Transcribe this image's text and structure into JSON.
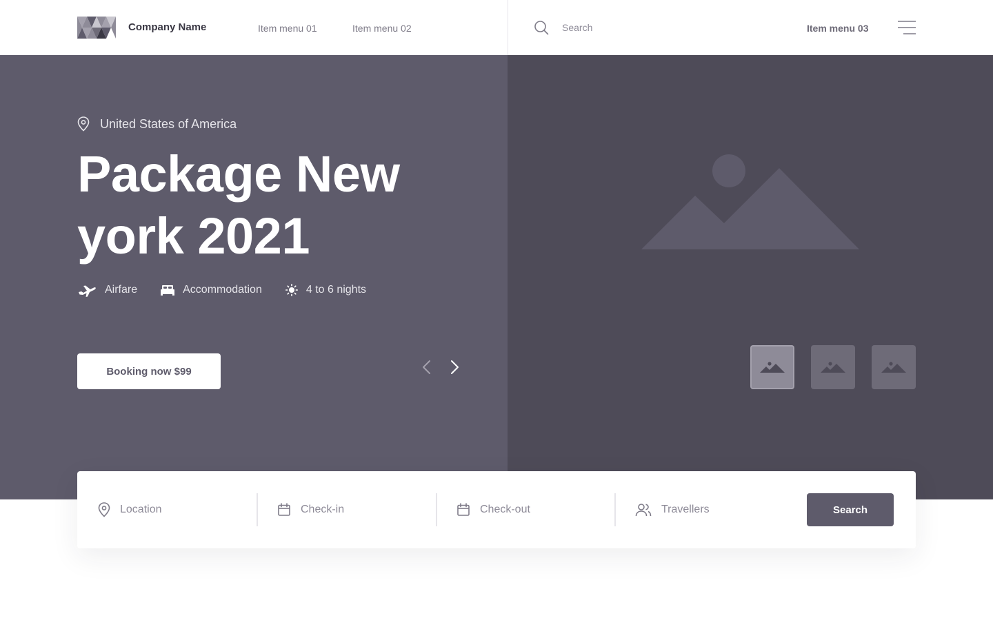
{
  "header": {
    "company_name": "Company Name",
    "nav": [
      "Item menu 01",
      "Item menu 02",
      "Item menu 03"
    ],
    "search_placeholder": "Search",
    "logo_icon": "triangles-logo",
    "menu_icon": "hamburger-icon"
  },
  "hero": {
    "location": "United States of America",
    "title": "Package New york 2021",
    "features": [
      {
        "icon": "airplane-icon",
        "label": "Airfare"
      },
      {
        "icon": "bed-icon",
        "label": "Accommodation"
      },
      {
        "icon": "sun-icon",
        "label": "4 to 6 nights"
      }
    ],
    "booking_label": "Booking now $99",
    "thumbnail_count": 3,
    "active_thumbnail": 1
  },
  "search_bar": {
    "fields": [
      {
        "icon": "pin-icon",
        "placeholder": "Location"
      },
      {
        "icon": "calendar-icon",
        "placeholder": "Check-in"
      },
      {
        "icon": "calendar-icon",
        "placeholder": "Check-out"
      },
      {
        "icon": "users-icon",
        "placeholder": "Travellers"
      }
    ],
    "button_label": "Search"
  },
  "colors": {
    "hero_left": "#5e5b6b",
    "hero_right": "#4e4b58",
    "accent": "#5e5b6b",
    "text_light": "#e6e5ea"
  }
}
